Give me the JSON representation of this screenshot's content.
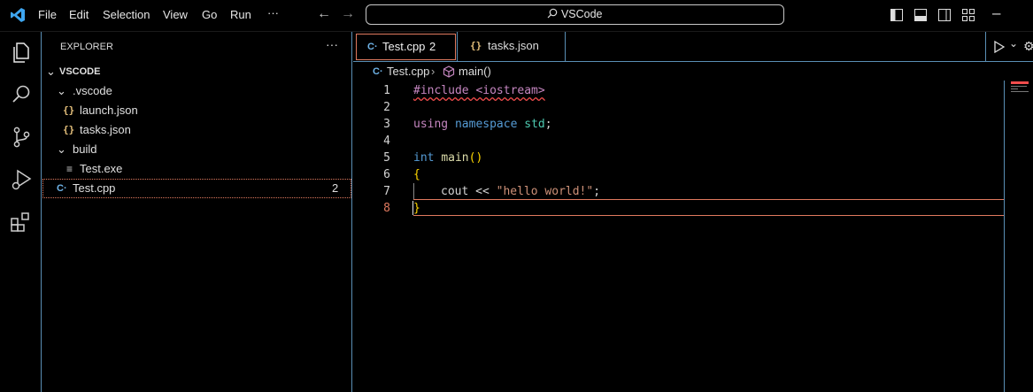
{
  "menu": [
    "File",
    "Edit",
    "Selection",
    "View",
    "Go",
    "Run",
    "···"
  ],
  "command_center": {
    "text": "VSCode"
  },
  "explorer": {
    "title": "EXPLORER",
    "more": "···",
    "root": "VSCODE",
    "items": [
      {
        "label": ".vscode",
        "kind": "folder"
      },
      {
        "label": "launch.json",
        "kind": "json"
      },
      {
        "label": "tasks.json",
        "kind": "json"
      },
      {
        "label": "build",
        "kind": "folder"
      },
      {
        "label": "Test.exe",
        "kind": "exe"
      },
      {
        "label": "Test.cpp",
        "kind": "cpp",
        "badge": "2"
      }
    ]
  },
  "tabs": [
    {
      "label": "Test.cpp",
      "badge": "2",
      "active": true
    },
    {
      "label": "tasks.json",
      "active": false
    }
  ],
  "breadcrumb": {
    "file": "Test.cpp",
    "symbol": "main()"
  },
  "editor": {
    "line_numbers": [
      "1",
      "2",
      "3",
      "4",
      "5",
      "6",
      "7",
      "8"
    ],
    "current_line": "8",
    "code": {
      "l1": "#include <iostream>",
      "l3_kw1": "using",
      "l3_kw2": "namespace",
      "l3_ns": "std",
      "l3_end": ";",
      "l5_type": "int",
      "l5_fn": "main",
      "l5_paren": "()",
      "l6": "{",
      "l7_id": "cout",
      "l7_op": " << ",
      "l7_str": "\"hello world!\"",
      "l7_end": ";",
      "l8": "}"
    }
  },
  "colors": {
    "accent": "#5a8fb5",
    "error": "#f14c4c",
    "selection_border": "#e07a5f"
  }
}
